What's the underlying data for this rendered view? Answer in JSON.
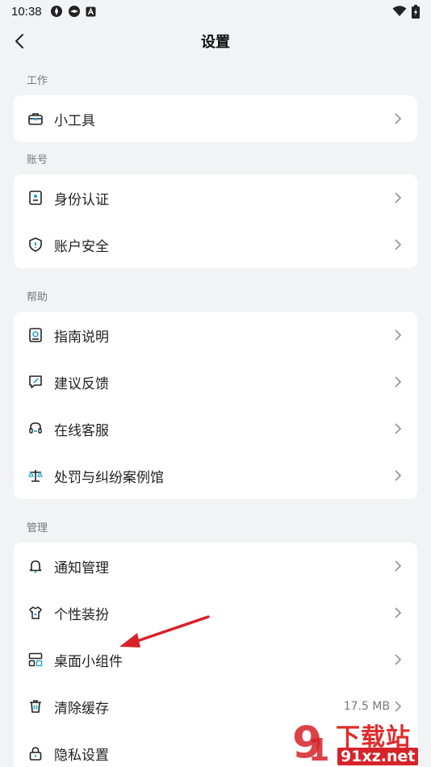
{
  "status": {
    "time": "10:38"
  },
  "nav": {
    "title": "设置"
  },
  "sections": {
    "work": {
      "label": "工作",
      "items": [
        {
          "label": "小工具"
        }
      ]
    },
    "account": {
      "label": "账号",
      "items": [
        {
          "label": "身份认证"
        },
        {
          "label": "账户安全"
        }
      ]
    },
    "help": {
      "label": "帮助",
      "items": [
        {
          "label": "指南说明"
        },
        {
          "label": "建议反馈"
        },
        {
          "label": "在线客服"
        },
        {
          "label": "处罚与纠纷案例馆"
        }
      ]
    },
    "manage": {
      "label": "管理",
      "items": [
        {
          "label": "通知管理"
        },
        {
          "label": "个性装扮"
        },
        {
          "label": "桌面小组件"
        },
        {
          "label": "清除缓存",
          "value": "17.5 MB"
        },
        {
          "label": "隐私设置"
        }
      ]
    }
  },
  "watermark": {
    "brand": "下载站",
    "url": "91xz.net"
  },
  "colors": {
    "background": "#f2f3f5",
    "card": "#ffffff",
    "arrow": "#d6232a"
  }
}
